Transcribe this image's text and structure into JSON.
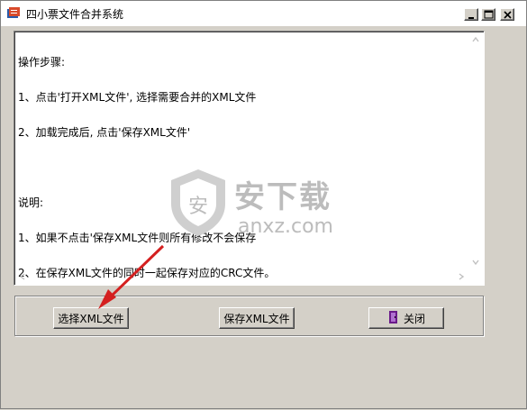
{
  "window": {
    "title": "四小票文件合并系统"
  },
  "instructions": {
    "lines": [
      "操作步骤:",
      "1、点击'打开XML文件', 选择需要合并的XML文件",
      "2、加载完成后, 点击'保存XML文件'",
      "",
      "说明:",
      "1、如果不点击'保存XML文件则所有修改不会保存",
      "2、在保存XML文件的同时一起保存对应的CRC文件。"
    ]
  },
  "watermark": {
    "text": "安下载",
    "sub": "anxz.com",
    "badge": "安"
  },
  "buttons": {
    "select_xml": "选择XML文件",
    "save_xml": "保存XML文件",
    "close": "关闭"
  },
  "colors": {
    "arrow": "#d42020",
    "watermark": "#bcbcbc"
  }
}
